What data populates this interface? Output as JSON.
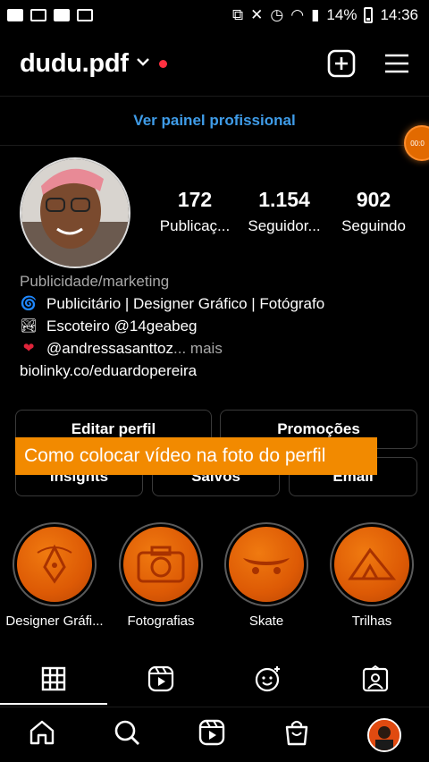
{
  "status_bar": {
    "battery": "14%",
    "time": "14:36"
  },
  "header": {
    "username": "dudu.pdf"
  },
  "pro_panel": {
    "label": "Ver painel profissional"
  },
  "floating_bubble": {
    "text": "00:0"
  },
  "stats": [
    {
      "value": "172",
      "label": "Publicaç..."
    },
    {
      "value": "1.154",
      "label": "Seguidor..."
    },
    {
      "value": "902",
      "label": "Seguindo"
    }
  ],
  "bio": {
    "category": "Publicidade/marketing",
    "line1": "Publicitário | Designer Gráfico | Fotógrafo",
    "line2": "Escoteiro @14geabeg",
    "line3": "@andressasanttoz",
    "line3_more_ellipsis": "...",
    "line3_more": "mais",
    "link": "biolinky.co/eduardopereira"
  },
  "buttons": {
    "edit_profile": "Editar perfil",
    "promotions": "Promoções",
    "insights": "Insights",
    "saved": "Salvos",
    "email": "Email"
  },
  "overlay_banner": "Como colocar vídeo na  foto do perfil",
  "highlights": [
    {
      "label": "Designer Gráfi..."
    },
    {
      "label": "Fotografias"
    },
    {
      "label": "Skate"
    },
    {
      "label": "Trilhas"
    }
  ],
  "colors": {
    "accent_link": "#3f9ce8",
    "banner": "#f28a00",
    "highlight": "#dd5a05",
    "notification_dot": "#ff3040"
  }
}
